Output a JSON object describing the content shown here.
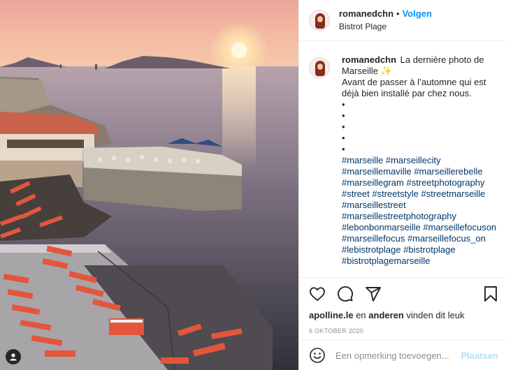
{
  "post": {
    "username": "romanedchn",
    "separator": "•",
    "follow_label": "Volgen",
    "location": "Bistrot Plage"
  },
  "caption": {
    "username": "romanedchn",
    "line1": "La dernière photo de Marseille ✨",
    "line2": "Avant de passer à l’automne qui est déjà bien installé par chez nous.",
    "bullets": [
      "•",
      "•",
      "•",
      "•",
      "•"
    ],
    "hashtags": [
      "#marseille",
      "#marseillecity",
      "#marseillemaville",
      "#marseillerebelle",
      "#marseillegram",
      "#streetphotography",
      "#street",
      "#streetstyle",
      "#streetmarseille",
      "#marseillestreet",
      "#marseillestreetphotography",
      "#lebonbonmarseille",
      "#marseillefocuson",
      "#marseillefocus",
      "#marseillefocus_on",
      "#lebistrotplage",
      "#bistrotplage",
      "#bistrotplagemarseille"
    ]
  },
  "actions": {
    "icons": [
      "heart-icon",
      "comment-icon",
      "share-icon",
      "bookmark-icon"
    ],
    "likes_user": "apolline.le",
    "likes_and": "en",
    "likes_others": "anderen",
    "likes_suffix": "vinden dit leuk",
    "date": "6 OKTOBER 2020"
  },
  "comment_box": {
    "placeholder": "Een opmerking toevoegen...",
    "post_label": "Plaatsen",
    "post_color": "#b2dffc"
  },
  "colors": {
    "link": "#00376b",
    "follow": "#0095f6",
    "secondary": "#8e8e8e"
  }
}
